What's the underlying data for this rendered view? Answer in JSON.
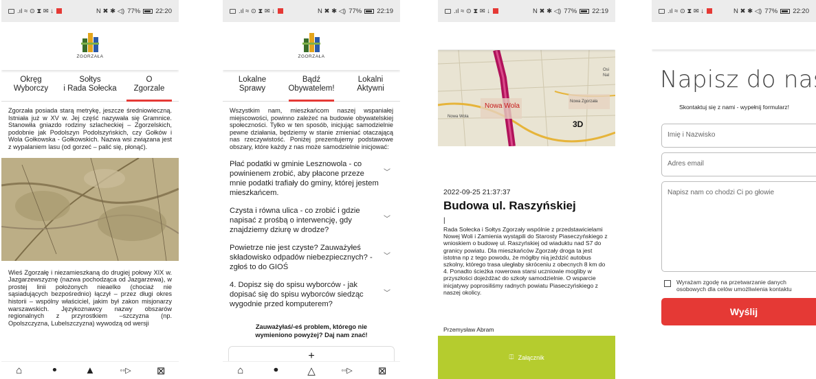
{
  "status": {
    "screen1_time": "22:20",
    "screen2_time": "22:19",
    "screen3_time": "22:19",
    "screen4_time": "22:20",
    "battery": "77%"
  },
  "logo": {
    "name": "ZGORZAŁA"
  },
  "screen1": {
    "tabs": [
      {
        "label": "Okręg\nWyborczy"
      },
      {
        "label": "Sołtys\ni Rada Sołecka"
      },
      {
        "label": "O\nZgorzale",
        "active": true
      }
    ],
    "paragraph1": "Zgorzała posiada starą metrykę, jeszcze średniowieczną. Istniała już w XV w. Jej część nazywała się Gramnice. Stanowiła gniazdo rodziny szlacheckiej – Zgorzelskich, podobnie jak Podolszyn Podolszyńskich, czy Gołków i Wola Gołkowska - Gołkowskich. Nazwa wsi związana jest z wypalaniem lasu (od gorzeć – palić się, płonąć).",
    "paragraph2": "Wieś Zgorzałę i niezamieszkaną do drugiej połowy XIX w. Jazgarzewszyznę (nazwa pochodząca od Jazgarzewa), w prostej linii położonych nieaelko (chociaż nie sąsiadujących bezpośrednio) łączył – przez długi okres historii – wspólny właściciel, jakim był zakon misjonarzy warszawskich. Językoznawcy nazwy obszarów regionalnych z przyrostkiem –szczyzna (np. Opolszczyzna, Lubelszczyzna) wywodzą od wersji"
  },
  "screen2": {
    "tabs": [
      {
        "label": "Lokalne\nSprawy"
      },
      {
        "label": "Bądź\nObywatelem!",
        "active": true
      },
      {
        "label": "Lokalni\nAktywni"
      }
    ],
    "intro": "Wszystkim nam, mieszkańcom naszej wspaniałej miejscowości, powinno zależeć na budowie obywatelskiej społeczności. Tylko w ten sposób, inicjując samodzielnie pewne działania, będziemy w stanie zmieniać otaczającą nas rzeczywistość. Poniżej prezentujemy podstawowe obszary, które każdy z nas może samodzielnie inicjować:",
    "items": [
      "Płać podatki w gminie Lesznowola - co powinienem zrobić, aby płacone przeze mnie podatki trafiały do gminy, której jestem mieszkańcem.",
      "Czysta i równa ulica - co zrobić i gdzie napisać z prośbą o interwencję, gdy znajdziemy dziurę w drodze?",
      "Powietrze nie jest czyste? Zauważyłeś składowisko odpadów niebezpiecznych? - zgłoś to do GIOŚ",
      "4. Dopisz się do spisu wyborców - jak dopisać się do spisu wyborców siedząc wygodnie przed komputerem?"
    ],
    "cta": "Zauważyłaś/-eś problem, którego nie wymieniono powyżej? Daj nam znać!",
    "plus": "+"
  },
  "screen3": {
    "map_labels": [
      "Nowa Wola",
      "Nowa Wola",
      "Nowa Zgorzała",
      "Osi",
      "Nal",
      "3D"
    ],
    "date": "2022-09-25 21:37:37",
    "title": "Budowa ul. Raszyńskiej",
    "cursor": "|",
    "body": "Rada Sołecka i Sołtys Zgorzały wspólnie z przedstawicielami Nowej Woli i Zamienia wystąpili do Starosty Piaseczyńskiego z wnioskiem o budowę ul. Raszyńskiej od wiaduktu nad S7 do granicy powiatu. Dla mieszkańców Zgorzały droga ta jest istotna np z tego powodu, że mógłby nią jeździć autobus szkolny, którego trasa uległaby skróceniu z obecnych 8 km do 4. Ponadto ścieżka rowerowa starsi uczniowie mogliby w przyszłości dojeżdżać do szkoły samodzielnie. O wsparcie inicjatywy poprosiliśmy radnych powiatu Piaseczyńskiego z naszej okolicy.",
    "author": "Przemysław Abram",
    "attachment": "Załącznik"
  },
  "screen4": {
    "title": "Napisz do nas!",
    "subtitle": "Skontaktuj się z nami - wypełnij formularz!",
    "name_placeholder": "Imię i Nazwisko",
    "email_placeholder": "Adres email",
    "message_placeholder": "Napisz nam co chodzi Ci po głowie",
    "consent": "Wyrażam zgodę na przetwarzanie danych\nosobowych dla celów umożliwienia kontaktu",
    "send": "Wyślij"
  },
  "nav_icons": [
    "home-icon",
    "people-icon",
    "buildings-icon",
    "megaphone-icon",
    "mail-icon"
  ],
  "colors": {
    "accent": "#e53935",
    "green": "#b5cc2e"
  }
}
